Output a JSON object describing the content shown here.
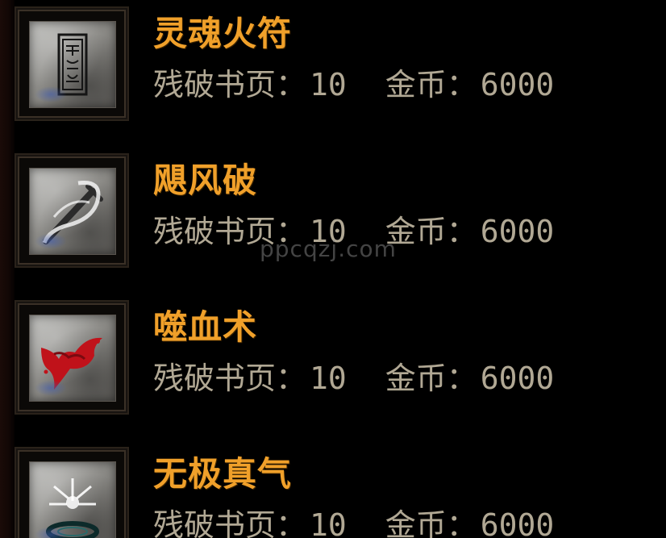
{
  "skills": [
    {
      "name": "灵魂火符",
      "icon": "talisman-icon",
      "cost_label": "残破书页：",
      "cost_value": "10",
      "gold_label": "金币：",
      "gold_value": "6000"
    },
    {
      "name": "飓风破",
      "icon": "whirlwind-sword-icon",
      "cost_label": "残破书页：",
      "cost_value": "10",
      "gold_label": "金币：",
      "gold_value": "6000"
    },
    {
      "name": "噬血术",
      "icon": "blood-splash-icon",
      "cost_label": "残破书页：",
      "cost_value": "10",
      "gold_label": "金币：",
      "gold_value": "6000"
    },
    {
      "name": "无极真气",
      "icon": "radiant-aura-icon",
      "cost_label": "残破书页：",
      "cost_value": "10",
      "gold_label": "金币：",
      "gold_value": "6000"
    }
  ],
  "watermark": "ppcqzj.com",
  "colors": {
    "name": "#f0a02a",
    "cost_text": "#b1a894",
    "background": "#000000"
  }
}
